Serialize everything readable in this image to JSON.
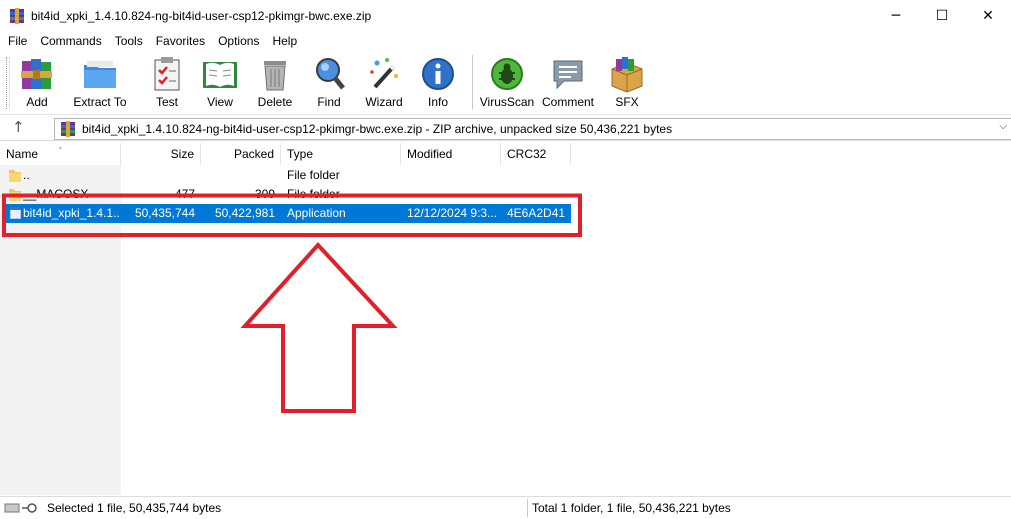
{
  "window": {
    "title": "bit4id_xpki_1.4.10.824-ng-bit4id-user-csp12-pkimgr-bwc.exe.zip",
    "minimize_glyph": "─",
    "maximize_glyph": "☐",
    "close_glyph": "✕"
  },
  "menu": [
    "File",
    "Commands",
    "Tools",
    "Favorites",
    "Options",
    "Help"
  ],
  "toolbar": {
    "add": "Add",
    "extract": "Extract To",
    "test": "Test",
    "view": "View",
    "delete": "Delete",
    "find": "Find",
    "wizard": "Wizard",
    "info": "Info",
    "virusscan": "VirusScan",
    "comment": "Comment",
    "sfx": "SFX"
  },
  "address": {
    "up_glyph": "↑",
    "path": "bit4id_xpki_1.4.10.824-ng-bit4id-user-csp12-pkimgr-bwc.exe.zip - ZIP archive, unpacked size 50,436,221 bytes",
    "dropdown_glyph": "⌵"
  },
  "columns": {
    "name": "Name",
    "size": "Size",
    "packed": "Packed",
    "type": "Type",
    "modified": "Modified",
    "crc": "CRC32",
    "sort_glyph": "⌃"
  },
  "rows": [
    {
      "name": "..",
      "size": "",
      "packed": "",
      "type": "File folder",
      "modified": "",
      "crc": ""
    },
    {
      "name": "__MACOSX",
      "size": "477",
      "packed": "309",
      "type": "File folder",
      "modified": "",
      "crc": ""
    },
    {
      "name": "bit4id_xpki_1.4.1...",
      "size": "50,435,744",
      "packed": "50,422,981",
      "type": "Application",
      "modified": "12/12/2024 9:3...",
      "crc": "4E6A2D41"
    }
  ],
  "status": {
    "left": "Selected 1 file, 50,435,744 bytes",
    "right": "Total 1 folder, 1 file, 50,436,221 bytes"
  },
  "colors": {
    "selection": "#0078d7",
    "annotation": "#e0202a"
  }
}
